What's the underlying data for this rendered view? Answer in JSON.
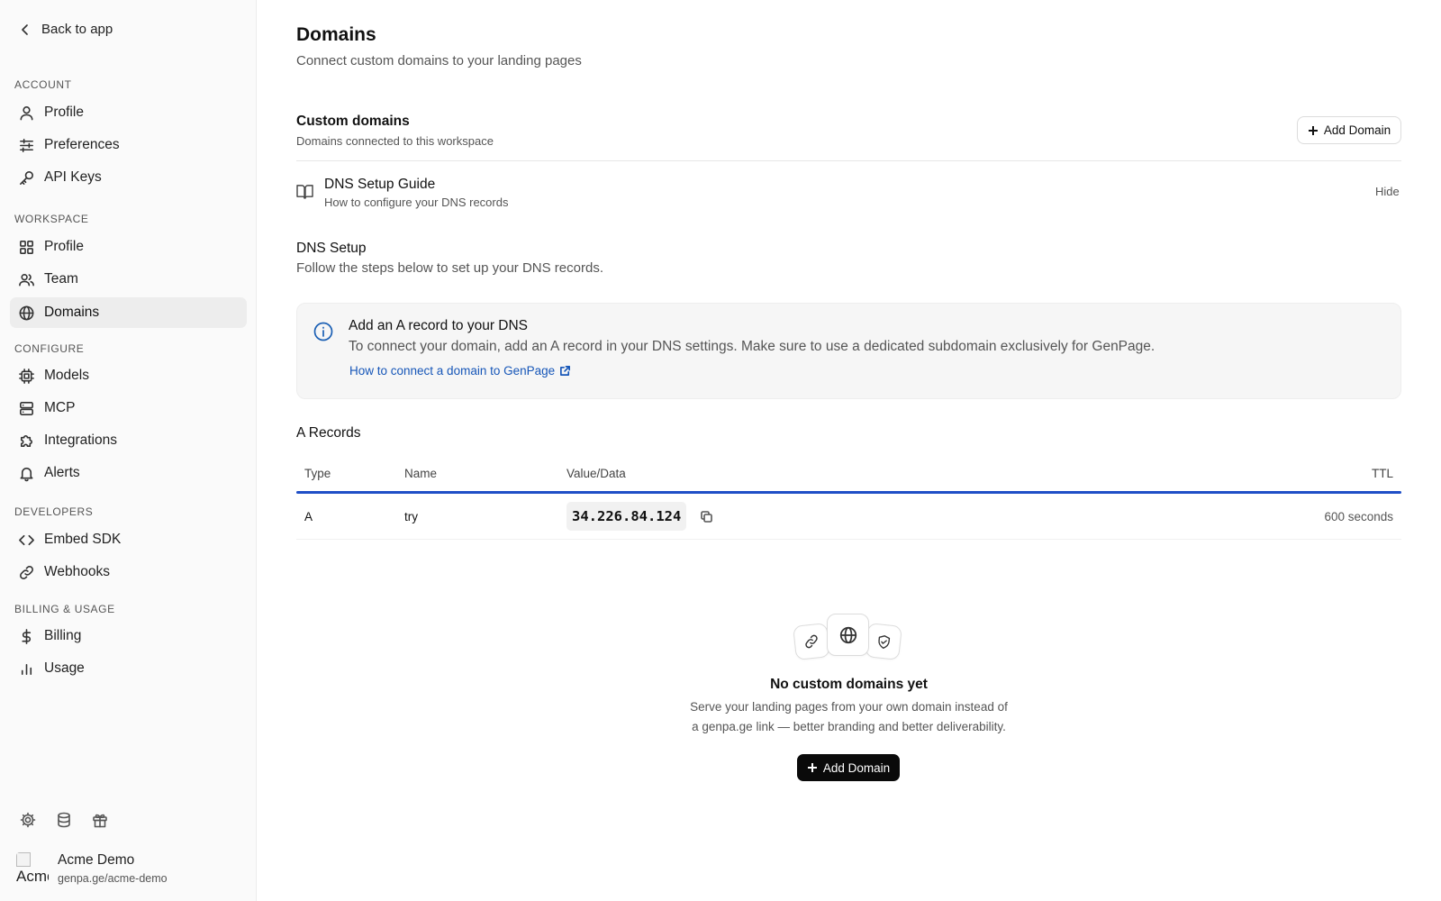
{
  "sidebar": {
    "back_label": "Back to app",
    "sections": {
      "account": "ACCOUNT",
      "workspace": "WORKSPACE",
      "configure": "CONFIGURE",
      "developers": "DEVELOPERS",
      "billing": "BILLING & USAGE"
    },
    "items": {
      "account_profile": "Profile",
      "preferences": "Preferences",
      "api_keys": "API Keys",
      "workspace_profile": "Profile",
      "team": "Team",
      "domains": "Domains",
      "models": "Models",
      "mcp": "MCP",
      "integrations": "Integrations",
      "alerts": "Alerts",
      "embed_sdk": "Embed SDK",
      "webhooks": "Webhooks",
      "billing": "Billing",
      "usage": "Usage"
    },
    "active_item": "Domains",
    "footer_icons": [
      "gear-icon",
      "database-icon",
      "gift-icon"
    ],
    "user": {
      "avatar_alt": "Acme",
      "name": "Acme Demo",
      "url": "genpa.ge/acme-demo"
    }
  },
  "header": {
    "title": "Domains",
    "subtitle": "Connect custom domains to your landing pages"
  },
  "custom_domains": {
    "title": "Custom domains",
    "subtitle": "Domains connected to this workspace",
    "add_button": "Add Domain"
  },
  "guide": {
    "title": "DNS Setup Guide",
    "subtitle": "How to configure your DNS records",
    "toggle": "Hide"
  },
  "dns_setup": {
    "title": "DNS Setup",
    "subtitle": "Follow the steps below to set up your DNS records.",
    "info": {
      "title": "Add an A record to your DNS",
      "body": "To connect your domain, add an A record in your DNS settings. Make sure to use a dedicated subdomain exclusively for GenPage.",
      "link": "How to connect a domain to GenPage"
    }
  },
  "a_records": {
    "title": "A Records",
    "columns": [
      "Type",
      "Name",
      "Value/Data",
      "TTL"
    ],
    "rows": [
      {
        "type": "A",
        "name": "try",
        "value": "34.226.84.124",
        "ttl": "600 seconds"
      }
    ]
  },
  "empty_state": {
    "title": "No custom domains yet",
    "line1": "Serve your landing pages from your own domain instead of",
    "line2": "a genpa.ge link — better branding and better deliverability.",
    "button": "Add Domain",
    "icons": [
      "link-icon",
      "globe-icon",
      "shield-icon"
    ]
  },
  "colors": {
    "accent_blue": "#1f4fc7",
    "link_blue": "#1656b8",
    "primary_button": "#0a0a0a",
    "sidebar_bg": "#fafafa",
    "active_item_bg": "#ededed"
  }
}
